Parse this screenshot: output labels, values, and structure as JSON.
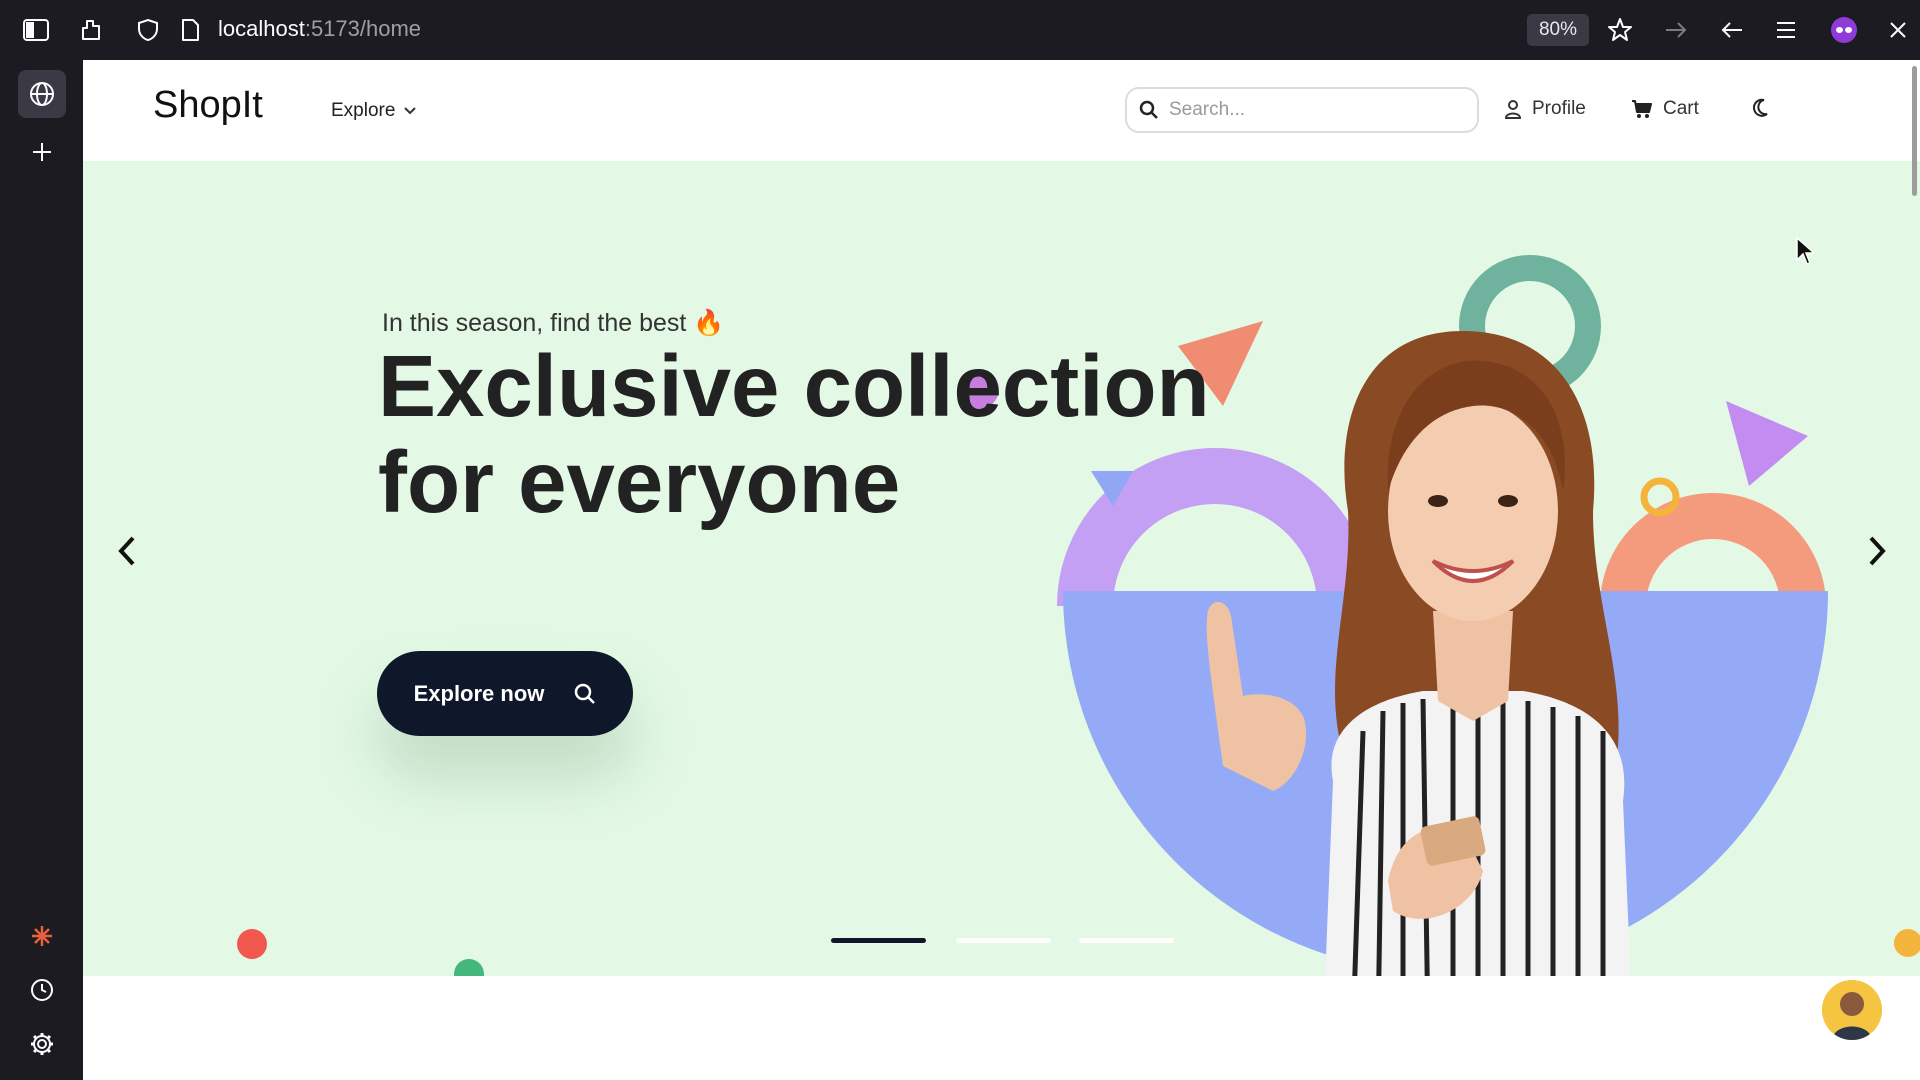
{
  "browser": {
    "url_host": "localhost",
    "url_path": ":5173/home",
    "zoom": "80%",
    "icons": [
      "sidebar-toggle-icon",
      "extensions-icon",
      "shield-icon",
      "page-icon",
      "star-icon",
      "forward-icon",
      "back-icon",
      "menu-icon",
      "private-mask-icon",
      "close-icon"
    ]
  },
  "sidebar": {
    "icons": [
      "globe-icon",
      "plus-icon",
      "sparkle-icon",
      "history-icon",
      "settings-icon"
    ]
  },
  "nav": {
    "logo": "ShopIt",
    "explore_label": "Explore",
    "search_placeholder": "Search...",
    "profile_label": "Profile",
    "cart_label": "Cart"
  },
  "hero": {
    "subtitle": "In this season, find the best 🔥",
    "title_line1": "Exclusive collection",
    "title_line2": "for everyone",
    "cta_label": "Explore now",
    "slides_total": 3,
    "active_slide": 1
  },
  "colors": {
    "hero_bg": "#e3f9e5",
    "cta_bg": "#0f172a",
    "semi_circle_blue": "#94aaf7",
    "arc_purple": "#c4a0f5",
    "arc_salmon": "#f59b7d",
    "ring_teal": "#6fb39f",
    "ring_yellow": "#f4b33a",
    "dot_red": "#f0584e",
    "dot_green": "#46b77c",
    "dot_purple": "#c77ddd"
  }
}
